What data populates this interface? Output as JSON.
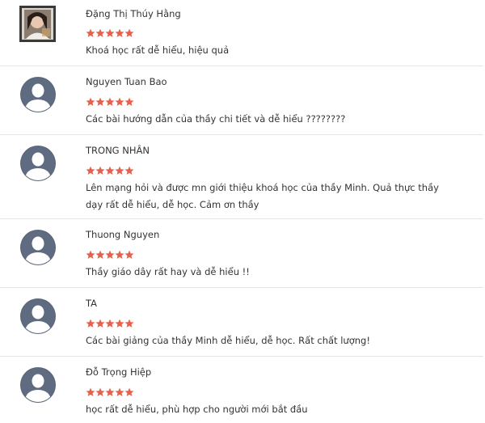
{
  "star_color": "#e8604c",
  "reviews": [
    {
      "author": "Đặng Thị Thúy Hằng",
      "rating": 5,
      "comment": "Khoá học rất dễ hiểu, hiệu quả",
      "avatar": "user-photo"
    },
    {
      "author": "Nguyen Tuan Bao",
      "rating": 5,
      "comment": "Các bài hướng dẫn của thầy chi tiết và dễ hiểu ????????",
      "avatar": "default-user-icon"
    },
    {
      "author": "TRONG NHÂN",
      "rating": 5,
      "comment": "Lên mạng hỏi và được mn giới thiệu khoá học của thầy Minh. Quả thực thầy dạy rất dễ hiểu, dễ học. Cảm ơn thầy",
      "avatar": "default-user-icon"
    },
    {
      "author": "Thuong Nguyen",
      "rating": 5,
      "comment": "Thầy giáo dây rất hay và dễ hiểu !!",
      "avatar": "default-user-icon"
    },
    {
      "author": "TA",
      "rating": 5,
      "comment": "Các bài giảng của thầy Minh dễ hiểu, dễ học. Rất chất lượng!",
      "avatar": "default-user-icon"
    },
    {
      "author": "Đỗ Trọng Hiệp",
      "rating": 5,
      "comment": "học rất dễ hiểu, phù hợp cho người mới bắt đầu",
      "avatar": "default-user-icon"
    }
  ]
}
